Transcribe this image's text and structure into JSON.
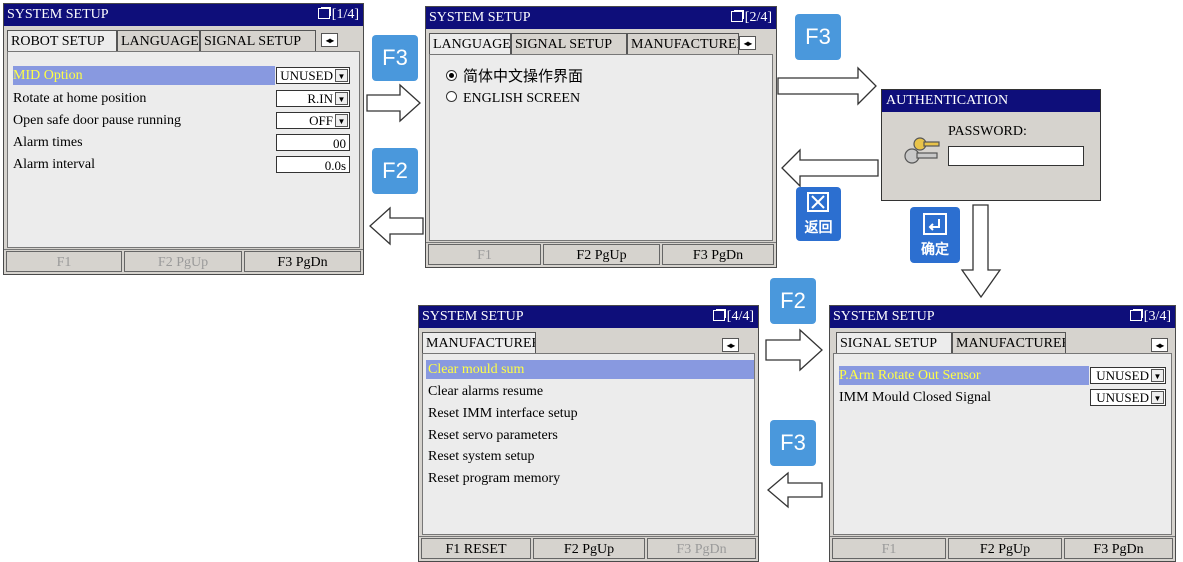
{
  "screen1": {
    "title": "SYSTEM SETUP",
    "page": "[1/4]",
    "tabs": [
      "ROBOT SETUP",
      "LANGUAGE",
      "SIGNAL SETUP"
    ],
    "rows": [
      {
        "label": "MID Option",
        "value": "UNUSED"
      },
      {
        "label": "Rotate at home position",
        "value": "R.IN"
      },
      {
        "label": "Open safe door pause running",
        "value": "OFF"
      },
      {
        "label": "Alarm times",
        "value": "00"
      },
      {
        "label": "Alarm interval",
        "value": "0.0s"
      }
    ],
    "fkeys": [
      "F1",
      "F2 PgUp",
      "F3 PgDn"
    ]
  },
  "screen2": {
    "title": "SYSTEM SETUP",
    "page": "[2/4]",
    "tabs": [
      "LANGUAGE",
      "SIGNAL SETUP",
      "MANUFACTURER"
    ],
    "options": [
      "简体中文操作界面",
      "ENGLISH SCREEN"
    ],
    "fkeys": [
      "F1",
      "F2 PgUp",
      "F3 PgDn"
    ]
  },
  "auth": {
    "title": "AUTHENTICATION",
    "password_label": "PASSWORD:",
    "password_value": ""
  },
  "screen3": {
    "title": "SYSTEM SETUP",
    "page": "[3/4]",
    "tabs": [
      "SIGNAL SETUP",
      "MANUFACTURER"
    ],
    "rows": [
      {
        "label": "P.Arm Rotate Out Sensor",
        "value": "UNUSED"
      },
      {
        "label": "IMM Mould Closed Signal",
        "value": "UNUSED"
      }
    ],
    "fkeys": [
      "F1",
      "F2 PgUp",
      "F3 PgDn"
    ]
  },
  "screen4": {
    "title": "SYSTEM SETUP",
    "page": "[4/4]",
    "tabs": [
      "MANUFACTURER"
    ],
    "items": [
      "Clear mould sum",
      "Clear alarms resume",
      "Reset IMM interface setup",
      "Reset servo parameters",
      "Reset system setup",
      "Reset program memory"
    ],
    "fkeys": [
      "F1 RESET",
      "F2 PgUp",
      "F3 PgDn"
    ]
  },
  "badges": {
    "f3_a": "F3",
    "f2_a": "F2",
    "f3_b": "F3",
    "f2_b": "F2",
    "f3_c": "F3",
    "back_label": "返回",
    "confirm_label": "确定"
  },
  "colors": {
    "title_bar": "#0e0e7a",
    "selected_row": "#8899e0",
    "selected_text": "#ffff44",
    "badge": "#4a98dc"
  }
}
